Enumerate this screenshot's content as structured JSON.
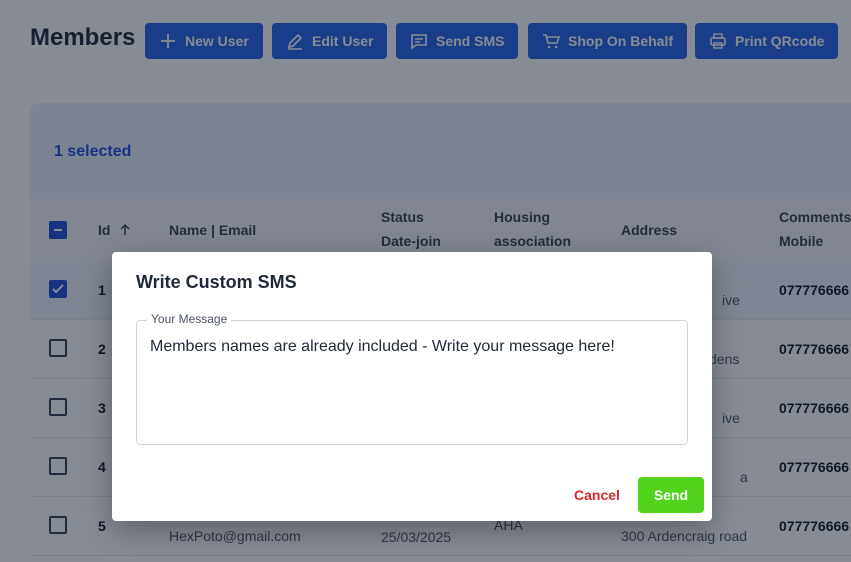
{
  "header": {
    "title": "Members",
    "buttons": {
      "new_user": "New User",
      "edit_user": "Edit User",
      "send_sms": "Send SMS",
      "shop_on_behalf": "Shop On Behalf",
      "print_qrcode": "Print QRcode"
    }
  },
  "selection": {
    "text": "1 selected"
  },
  "table": {
    "columns": {
      "id": "Id",
      "name_email": "Name | Email",
      "status": "Status",
      "date_join": "Date-join",
      "housing": "Housing",
      "housing2": "association",
      "address": "Address",
      "comments": "Comments",
      "mobile": "Mobile"
    },
    "rows": [
      {
        "id": "1",
        "address_partial": "ive",
        "mobile": "077776666",
        "selected": true
      },
      {
        "id": "2",
        "address_partial": "dens",
        "mobile": "077776666",
        "selected": false
      },
      {
        "id": "3",
        "address_partial": "ive",
        "mobile": "077776666",
        "selected": false
      },
      {
        "id": "4",
        "address_partial": "a",
        "mobile": "077776666",
        "selected": false
      },
      {
        "id": "5",
        "email": "HexPoto@gmail.com",
        "date": "25/03/2025",
        "housing": "AHA",
        "address": "300 Ardencraig road",
        "mobile": "077776666",
        "selected": false
      }
    ]
  },
  "dialog": {
    "title": "Write Custom SMS",
    "field_label": "Your Message",
    "placeholder": "Members names are already included - Write your message here!",
    "cancel": "Cancel",
    "send": "Send"
  },
  "colors": {
    "primary": "#2563eb",
    "send": "#52d41e",
    "cancel": "#dc2626"
  }
}
